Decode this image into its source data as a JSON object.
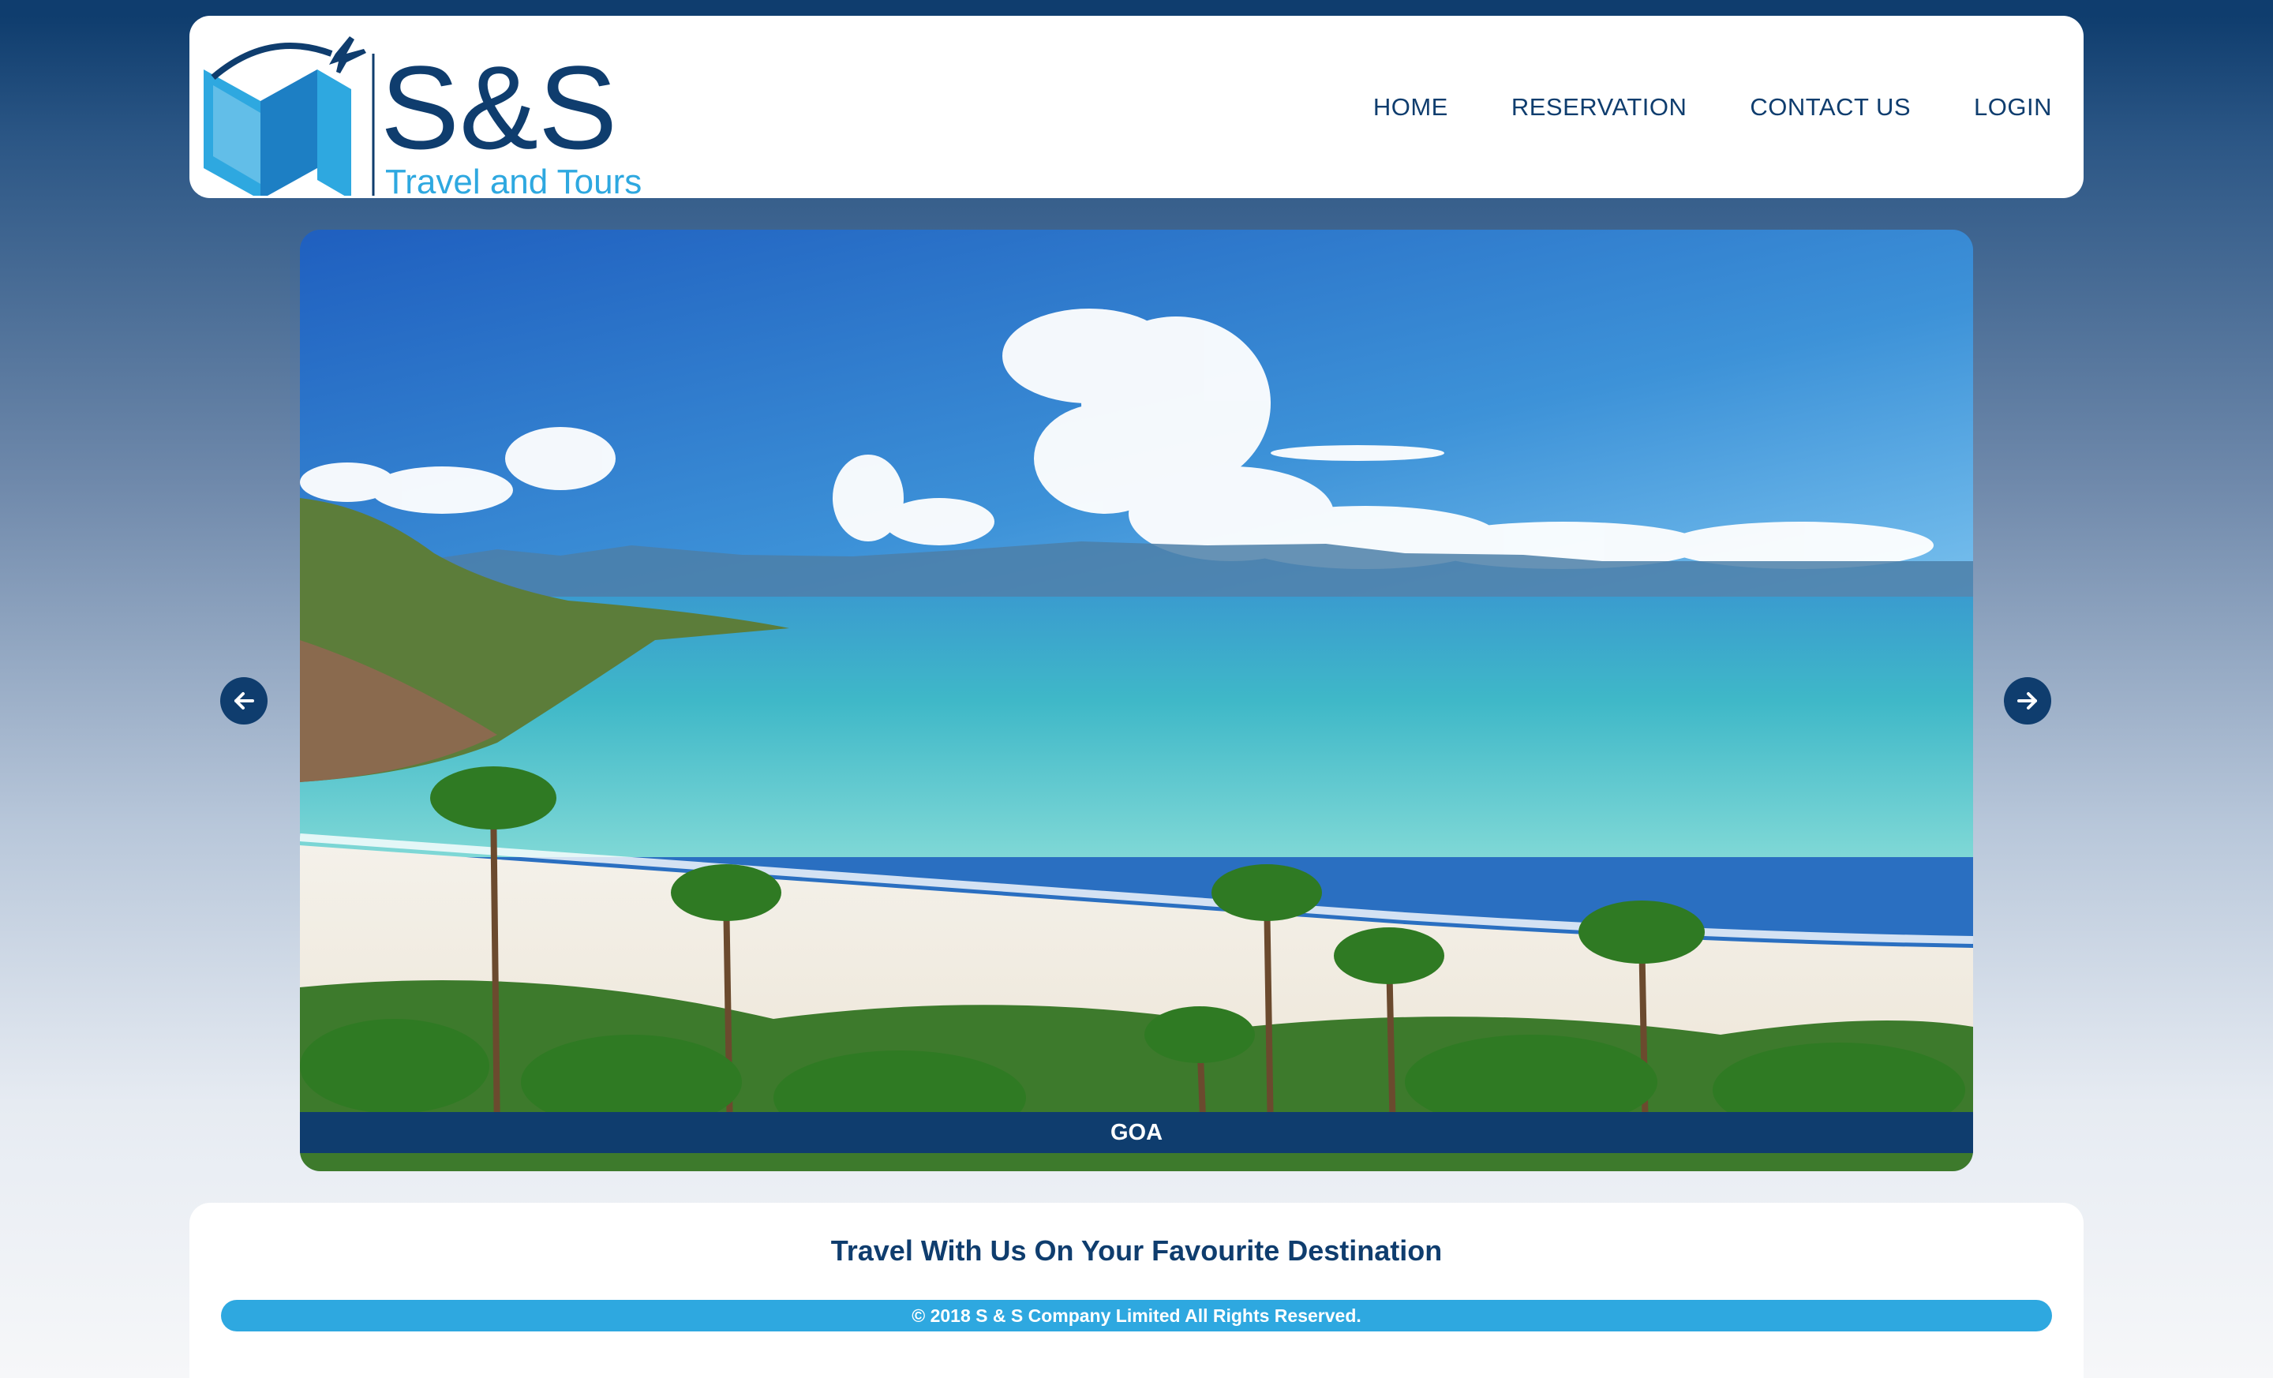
{
  "brand": {
    "name": "S&S",
    "subtitle": "Travel and Tours",
    "primary_color": "#0f3d6e",
    "accent_color": "#2ea8e0"
  },
  "nav": {
    "items": [
      {
        "label": "HOME"
      },
      {
        "label": "RESERVATION"
      },
      {
        "label": "CONTACT US"
      },
      {
        "label": "LOGIN"
      }
    ]
  },
  "slider": {
    "caption": "GOA",
    "prev_icon": "arrow-left-icon",
    "next_icon": "arrow-right-icon"
  },
  "content": {
    "tagline": "Travel With Us On Your Favourite Destination"
  },
  "footer": {
    "copyright": "© 2018 S & S Company Limited All Rights Reserved."
  }
}
